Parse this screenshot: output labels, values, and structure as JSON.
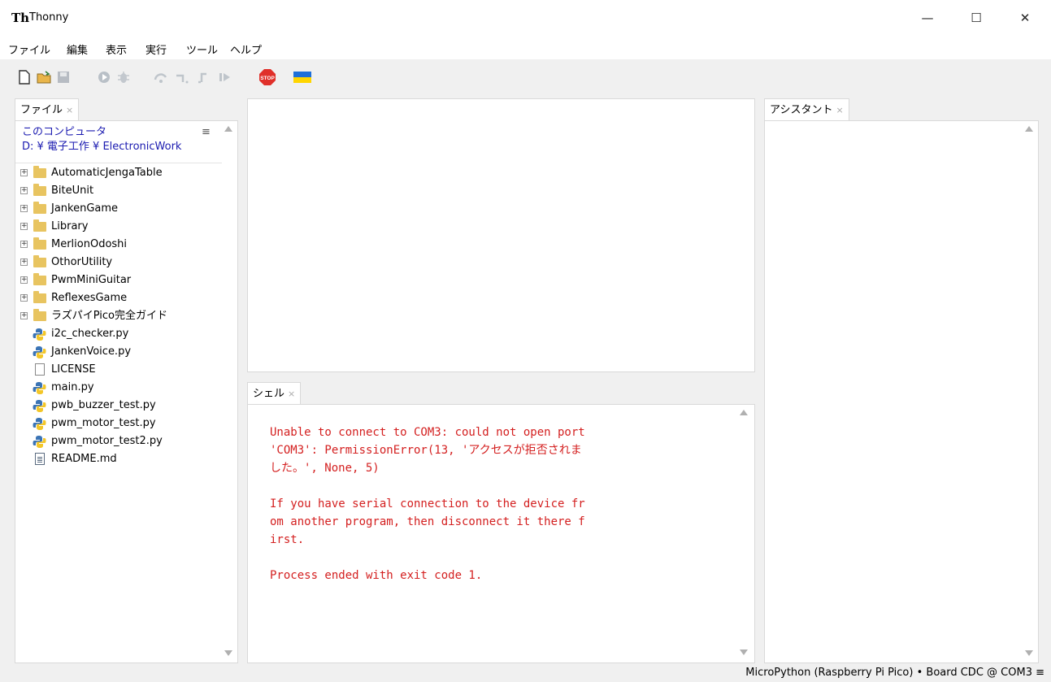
{
  "window": {
    "title": "Thonny",
    "logo_text": "Th",
    "minimize": "—",
    "maximize": "☐",
    "close": "✕"
  },
  "menu": [
    "ファイル",
    "編集",
    "表示",
    "実行",
    "ツール",
    "ヘルプ"
  ],
  "toolbar": {
    "icons": [
      "new-file-icon",
      "open-file-icon",
      "save-icon",
      "run-icon",
      "debug-icon",
      "step-over-icon",
      "step-into-icon",
      "step-out-icon",
      "resume-icon",
      "stop-icon",
      "ukraine-flag-icon"
    ],
    "stop_label": "STOP",
    "colors": {
      "stop": "#e0302a",
      "flag_blue": "#1e6fd9",
      "flag_yellow": "#ffd500"
    }
  },
  "files_panel": {
    "tab": "ファイル",
    "location_title": "このコンピュータ",
    "path": "D: ¥ 電子工作 ¥ ElectronicWork",
    "menu_icon": "≡",
    "items": [
      {
        "name": "AutomaticJengaTable",
        "type": "folder"
      },
      {
        "name": "BiteUnit",
        "type": "folder"
      },
      {
        "name": "JankenGame",
        "type": "folder"
      },
      {
        "name": "Library",
        "type": "folder"
      },
      {
        "name": "MerlionOdoshi",
        "type": "folder"
      },
      {
        "name": "OthorUtility",
        "type": "folder"
      },
      {
        "name": "PwmMiniGuitar",
        "type": "folder"
      },
      {
        "name": "ReflexesGame",
        "type": "folder"
      },
      {
        "name": "ラズパイPico完全ガイド",
        "type": "folder"
      },
      {
        "name": "i2c_checker.py",
        "type": "python"
      },
      {
        "name": "JankenVoice.py",
        "type": "python"
      },
      {
        "name": "LICENSE",
        "type": "file"
      },
      {
        "name": "main.py",
        "type": "python"
      },
      {
        "name": "pwb_buzzer_test.py",
        "type": "python"
      },
      {
        "name": "pwm_motor_test.py",
        "type": "python"
      },
      {
        "name": "pwm_motor_test2.py",
        "type": "python"
      },
      {
        "name": "README.md",
        "type": "markdown"
      }
    ],
    "expander": "+"
  },
  "shell": {
    "tab": "シェル",
    "output": "Unable to connect to COM3: could not open port\n'COM3': PermissionError(13, 'アクセスが拒否されま\nした。', None, 5)\n\nIf you have serial connection to the device fr\nom another program, then disconnect it there f\nirst.\n\nProcess ended with exit code 1.",
    "color": "#d42020"
  },
  "assistant": {
    "tab": "アシスタント"
  },
  "tab_close": "×",
  "status": {
    "interpreter": "MicroPython (Raspberry Pi Pico)  •  Board CDC @ COM3  ≡"
  }
}
